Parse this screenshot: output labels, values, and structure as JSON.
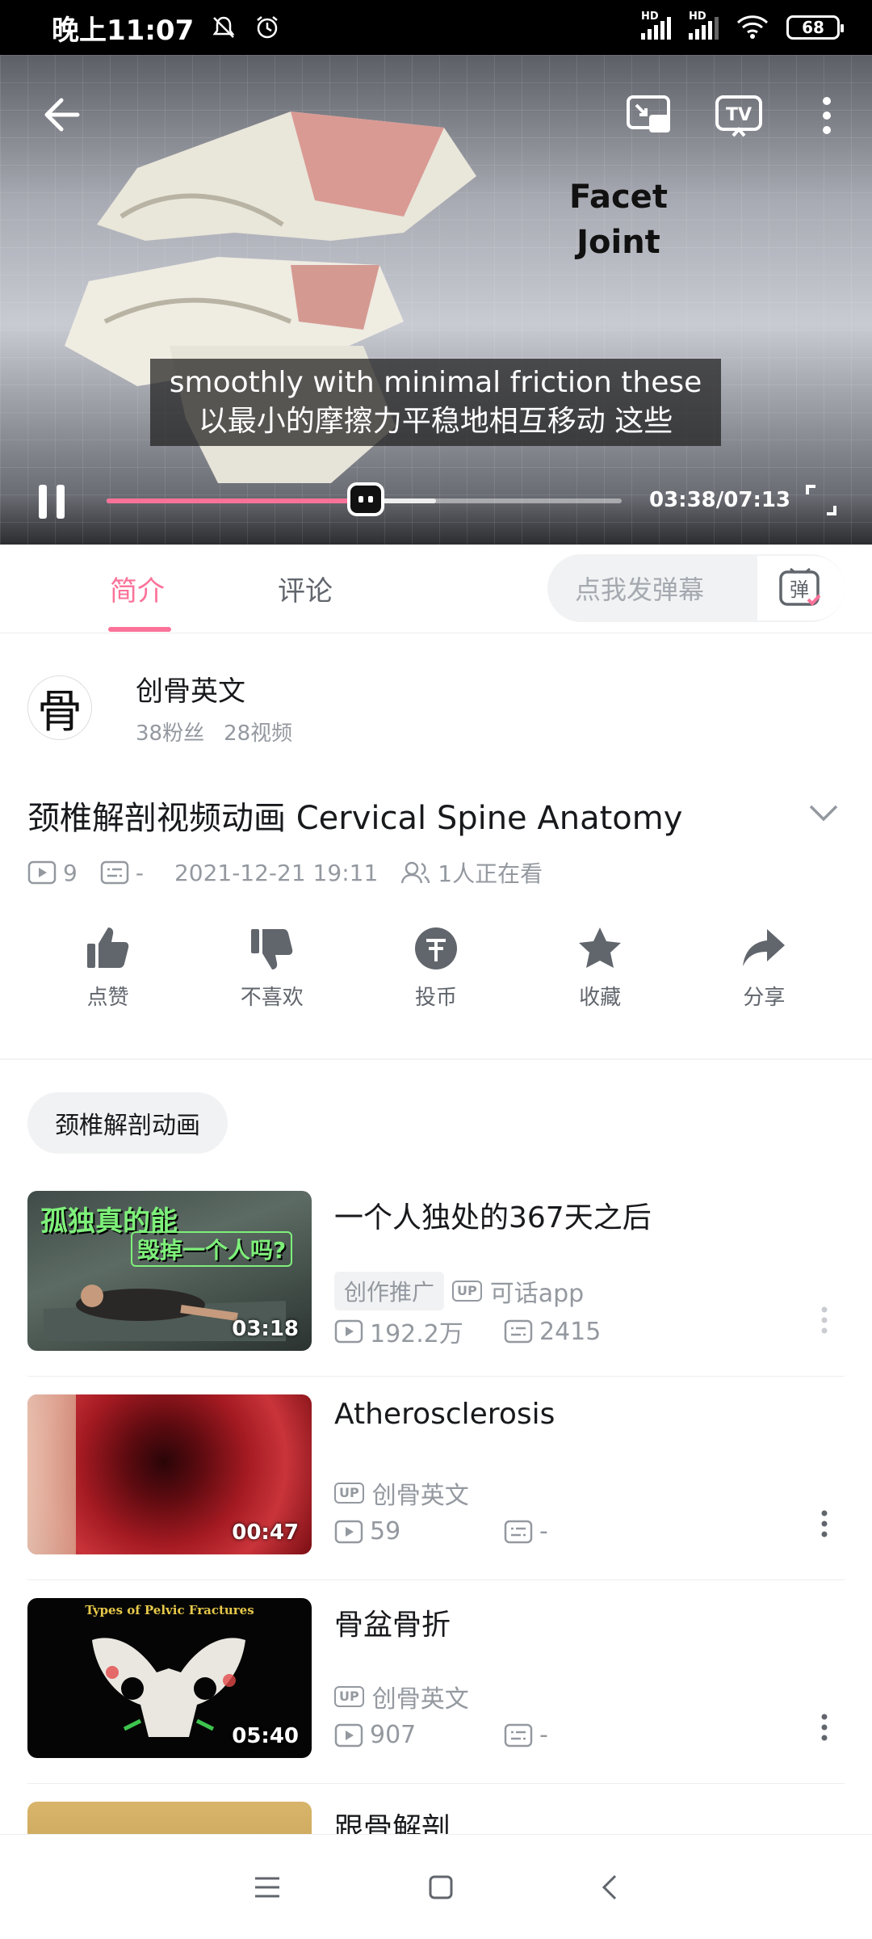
{
  "status_bar": {
    "time": "晚上11:07",
    "battery": "68",
    "icons": [
      "mute-icon",
      "alarm-icon",
      "hd-signal-icon",
      "hd-signal-icon",
      "wifi-icon",
      "battery-icon"
    ]
  },
  "player": {
    "overlay_text": [
      "Facet",
      "Joint"
    ],
    "subtitle_en": "smoothly with minimal friction these",
    "subtitle_zh": "以最小的摩擦力平稳地相互移动 这些",
    "current_time": "03:38",
    "total_time": "07:13",
    "time_display": "03:38/07:13",
    "played_fraction": 0.503,
    "buffered_fraction": 0.64,
    "icons": [
      "back-arrow-icon",
      "cast-icon",
      "tv-icon",
      "more-vertical-icon",
      "pause-icon",
      "fullscreen-icon"
    ]
  },
  "tabs": [
    {
      "label": "简介",
      "active": true
    },
    {
      "label": "评论",
      "active": false
    }
  ],
  "danmaku": {
    "placeholder": "点我发弹幕",
    "button_label": "弹"
  },
  "uploader": {
    "avatar_char": "骨",
    "name": "创骨英文",
    "fans": "38粉丝",
    "videos": "28视频"
  },
  "video": {
    "title": "颈椎解剖视频动画 Cervical Spine Anatomy",
    "plays": "9",
    "danmaku_count": "-",
    "date": "2021-12-21 19:11",
    "watching": "1人正在看"
  },
  "actions": [
    {
      "label": "点赞",
      "icon": "thumbs-up-icon"
    },
    {
      "label": "不喜欢",
      "icon": "thumbs-down-icon"
    },
    {
      "label": "投币",
      "icon": "coin-icon"
    },
    {
      "label": "收藏",
      "icon": "star-icon"
    },
    {
      "label": "分享",
      "icon": "share-icon"
    }
  ],
  "collection_chip": "颈椎解剖动画",
  "recommendations": [
    {
      "title": "一个人独处的367天之后",
      "duration": "03:18",
      "promo": "创作推广",
      "up_badge": "UP",
      "author": "可话app",
      "plays": "192.2万",
      "danmaku": "2415",
      "thumb_caption_1": "孤独真的能",
      "thumb_caption_2": "毁掉一个人吗?"
    },
    {
      "title": "Atherosclerosis",
      "duration": "00:47",
      "up_badge": "UP",
      "author": "创骨英文",
      "plays": "59",
      "danmaku": "-"
    },
    {
      "title": "骨盆骨折",
      "duration": "05:40",
      "up_badge": "UP",
      "author": "创骨英文",
      "plays": "907",
      "danmaku": "-",
      "thumb_caption_1": "Types of Pelvic Fractures"
    },
    {
      "title": "跟骨解剖"
    }
  ],
  "colors": {
    "accent": "#fb7299",
    "text_primary": "#18191c",
    "text_secondary": "#9499a0"
  }
}
